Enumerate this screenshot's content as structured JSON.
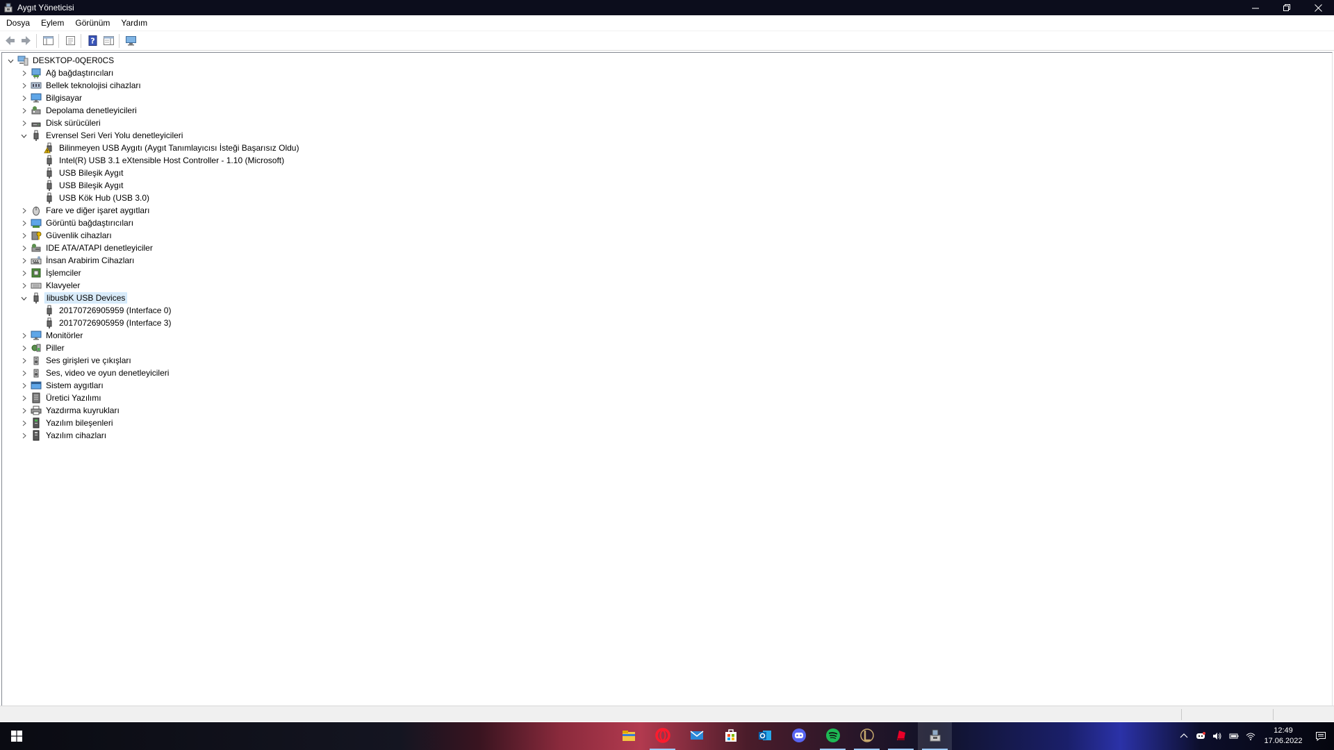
{
  "window": {
    "title": "Aygıt Yöneticisi"
  },
  "menu": [
    "Dosya",
    "Eylem",
    "Görünüm",
    "Yardım"
  ],
  "toolbar": {
    "icons": [
      "back-arrow-icon",
      "forward-arrow-icon",
      "show-hide-tree-icon",
      "properties-icon",
      "help-icon",
      "action-pane-icon",
      "monitor-scan-icon"
    ]
  },
  "tree": [
    {
      "level": 0,
      "label": "DESKTOP-0QER0CS",
      "icon": "computer-icon",
      "expander": "expanded"
    },
    {
      "level": 1,
      "label": "Ağ bağdaştırıcıları",
      "icon": "network-adapter-icon",
      "expander": "collapsed"
    },
    {
      "level": 1,
      "label": "Bellek teknolojisi cihazları",
      "icon": "memory-device-icon",
      "expander": "collapsed"
    },
    {
      "level": 1,
      "label": "Bilgisayar",
      "icon": "monitor-icon",
      "expander": "collapsed"
    },
    {
      "level": 1,
      "label": "Depolama denetleyicileri",
      "icon": "storage-controller-icon",
      "expander": "collapsed"
    },
    {
      "level": 1,
      "label": "Disk sürücüleri",
      "icon": "disk-drive-icon",
      "expander": "collapsed"
    },
    {
      "level": 1,
      "label": "Evrensel Seri Veri Yolu denetleyicileri",
      "icon": "usb-icon",
      "expander": "expanded"
    },
    {
      "level": 2,
      "label": "Bilinmeyen USB Aygıtı (Aygıt Tanımlayıcısı İsteği Başarısız Oldu)",
      "icon": "usb-warning-icon",
      "expander": "none"
    },
    {
      "level": 2,
      "label": "Intel(R) USB 3.1 eXtensible Host Controller - 1.10 (Microsoft)",
      "icon": "usb-icon",
      "expander": "none"
    },
    {
      "level": 2,
      "label": "USB Bileşik Aygıt",
      "icon": "usb-icon",
      "expander": "none"
    },
    {
      "level": 2,
      "label": "USB Bileşik Aygıt",
      "icon": "usb-icon",
      "expander": "none"
    },
    {
      "level": 2,
      "label": "USB Kök Hub (USB 3.0)",
      "icon": "usb-icon",
      "expander": "none"
    },
    {
      "level": 1,
      "label": "Fare ve diğer işaret aygıtları",
      "icon": "mouse-icon",
      "expander": "collapsed"
    },
    {
      "level": 1,
      "label": "Görüntü bağdaştırıcıları",
      "icon": "display-adapter-icon",
      "expander": "collapsed"
    },
    {
      "level": 1,
      "label": "Güvenlik cihazları",
      "icon": "security-device-icon",
      "expander": "collapsed"
    },
    {
      "level": 1,
      "label": "IDE ATA/ATAPI denetleyiciler",
      "icon": "ide-controller-icon",
      "expander": "collapsed"
    },
    {
      "level": 1,
      "label": "İnsan Arabirim Cihazları",
      "icon": "hid-icon",
      "expander": "collapsed"
    },
    {
      "level": 1,
      "label": "İşlemciler",
      "icon": "processor-icon",
      "expander": "collapsed"
    },
    {
      "level": 1,
      "label": "Klavyeler",
      "icon": "keyboard-icon",
      "expander": "collapsed"
    },
    {
      "level": 1,
      "label": "libusbK USB Devices",
      "icon": "usb-icon",
      "expander": "expanded",
      "selected": true
    },
    {
      "level": 2,
      "label": "20170726905959 (Interface 0)",
      "icon": "usb-icon",
      "expander": "none"
    },
    {
      "level": 2,
      "label": "20170726905959 (Interface 3)",
      "icon": "usb-icon",
      "expander": "none"
    },
    {
      "level": 1,
      "label": "Monitörler",
      "icon": "monitor-icon",
      "expander": "collapsed"
    },
    {
      "level": 1,
      "label": "Piller",
      "icon": "battery-icon",
      "expander": "collapsed"
    },
    {
      "level": 1,
      "label": "Ses girişleri ve çıkışları",
      "icon": "speaker-icon",
      "expander": "collapsed"
    },
    {
      "level": 1,
      "label": "Ses, video ve oyun denetleyicileri",
      "icon": "speaker-icon",
      "expander": "collapsed"
    },
    {
      "level": 1,
      "label": "Sistem aygıtları",
      "icon": "system-devices-icon",
      "expander": "collapsed"
    },
    {
      "level": 1,
      "label": "Üretici Yazılımı",
      "icon": "firmware-icon",
      "expander": "collapsed"
    },
    {
      "level": 1,
      "label": "Yazdırma kuyrukları",
      "icon": "printer-icon",
      "expander": "collapsed"
    },
    {
      "level": 1,
      "label": "Yazılım bileşenleri",
      "icon": "software-component-icon",
      "expander": "collapsed"
    },
    {
      "level": 1,
      "label": "Yazılım cihazları",
      "icon": "software-device-icon",
      "expander": "collapsed"
    }
  ],
  "taskbar": {
    "apps": [
      {
        "icon": "file-explorer-icon",
        "active": false
      },
      {
        "icon": "opera-icon",
        "active": true
      },
      {
        "icon": "mail-icon",
        "active": false
      },
      {
        "icon": "store-icon",
        "active": false
      },
      {
        "icon": "outlook-icon",
        "active": false
      },
      {
        "icon": "discord-icon",
        "active": false
      },
      {
        "icon": "spotify-icon",
        "active": true
      },
      {
        "icon": "league-icon",
        "active": true
      },
      {
        "icon": "riot-icon",
        "active": true
      },
      {
        "icon": "device-manager-icon",
        "active": true,
        "focused": true
      }
    ],
    "tray_icons": [
      "chevron-up-icon",
      "discord-tray-icon",
      "volume-icon",
      "battery-tray-icon",
      "wifi-icon"
    ],
    "time": "12:49",
    "date": "17.06.2022"
  },
  "colors": {
    "titlebar": "#0c0d1c",
    "selection": "#d9ebf9",
    "accent": "#0078d7"
  }
}
